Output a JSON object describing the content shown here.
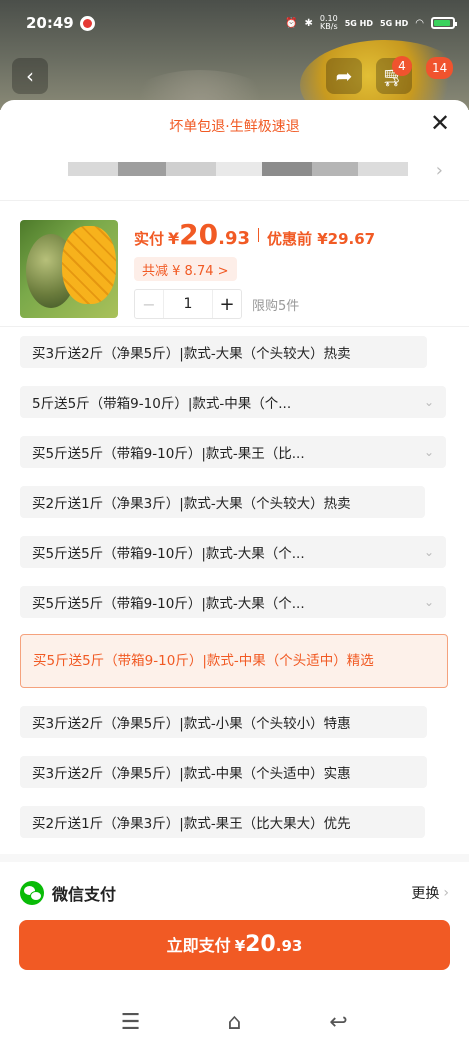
{
  "status_bar": {
    "time": "20:49",
    "speed_value": "0.10",
    "speed_unit": "KB/s",
    "signal1": "5G HD",
    "signal2": "5G HD"
  },
  "nav": {
    "cart_count": "4",
    "more_count": "14"
  },
  "sheet": {
    "promo_text": "坏单包退·生鲜极速退",
    "address_mask_colors": [
      "#d9d9d9",
      "#9e9e9e",
      "#cfcfcf",
      "#e9e9e9",
      "#8c8c8c",
      "#b5b5b5",
      "#dcdcdc",
      "#aaaaaa",
      "#e3e3e3"
    ]
  },
  "product": {
    "paid_label": "实付",
    "currency": "¥",
    "price_int": "20",
    "price_dec": ".93",
    "orig_label": "优惠前 ¥29.67",
    "saved_label": "共减 ¥ 8.74 >",
    "quantity": "1",
    "minus": "−",
    "plus": "+",
    "limit": "限购5件"
  },
  "options": [
    {
      "label": "买3斤送2斤（净果5斤）|款式-大果（个头较大）热卖",
      "chev": ""
    },
    {
      "label": "5斤送5斤（带箱9-10斤）|款式-中果（个...",
      "chev": "⌄"
    },
    {
      "label": "买5斤送5斤（带箱9-10斤）|款式-果王（比...",
      "chev": "⌄"
    },
    {
      "label": "买2斤送1斤（净果3斤）|款式-大果（个头较大）热卖",
      "chev": ""
    },
    {
      "label": "买5斤送5斤（带箱9-10斤）|款式-大果（个...",
      "chev": "⌄"
    },
    {
      "label": "买5斤送5斤（带箱9-10斤）|款式-大果（个...",
      "chev": "⌄"
    },
    {
      "label": "买5斤送5斤（带箱9-10斤）|款式-中果（个头适中）精选",
      "chev": "",
      "selected": true
    },
    {
      "label": "买3斤送2斤（净果5斤）|款式-小果（个头较小）特惠",
      "chev": ""
    },
    {
      "label": "买3斤送2斤（净果5斤）|款式-中果（个头适中）实惠",
      "chev": ""
    },
    {
      "label": "买2斤送1斤（净果3斤）|款式-果王（比大果大）优先",
      "chev": ""
    }
  ],
  "payment": {
    "method": "微信支付",
    "change": "更换",
    "button_text": "立即支付",
    "currency": "¥",
    "amount_int": "20",
    "amount_dec": ".93"
  },
  "colors": {
    "accent": "#f15a24",
    "wechat": "#09bb07"
  }
}
